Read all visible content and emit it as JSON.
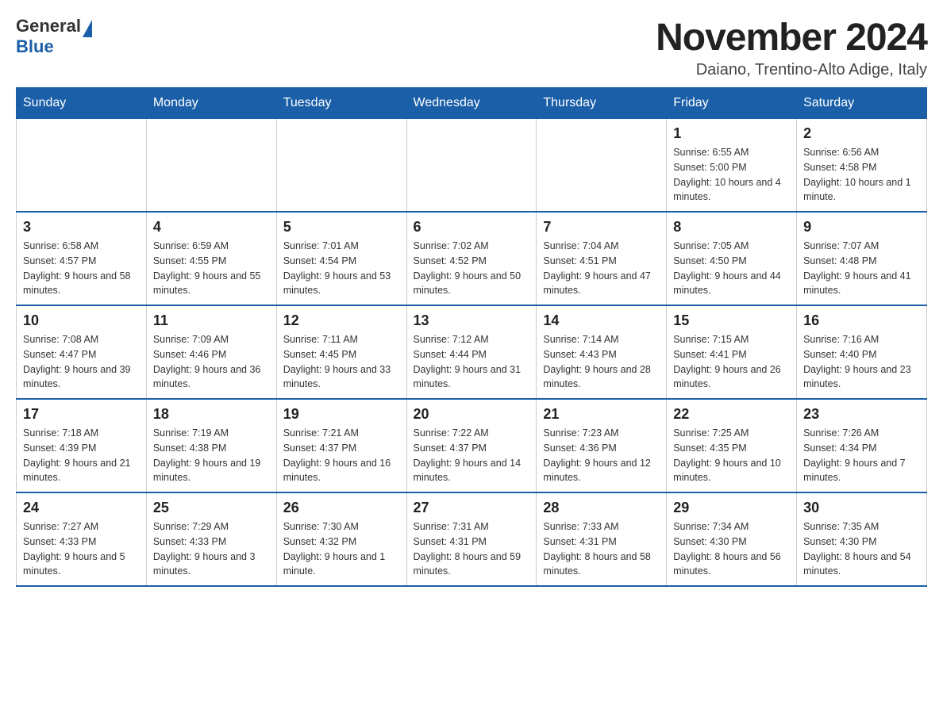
{
  "header": {
    "logo_general": "General",
    "logo_blue": "Blue",
    "title": "November 2024",
    "location": "Daiano, Trentino-Alto Adige, Italy"
  },
  "weekdays": [
    "Sunday",
    "Monday",
    "Tuesday",
    "Wednesday",
    "Thursday",
    "Friday",
    "Saturday"
  ],
  "weeks": [
    [
      {
        "day": "",
        "info": ""
      },
      {
        "day": "",
        "info": ""
      },
      {
        "day": "",
        "info": ""
      },
      {
        "day": "",
        "info": ""
      },
      {
        "day": "",
        "info": ""
      },
      {
        "day": "1",
        "info": "Sunrise: 6:55 AM\nSunset: 5:00 PM\nDaylight: 10 hours and 4 minutes."
      },
      {
        "day": "2",
        "info": "Sunrise: 6:56 AM\nSunset: 4:58 PM\nDaylight: 10 hours and 1 minute."
      }
    ],
    [
      {
        "day": "3",
        "info": "Sunrise: 6:58 AM\nSunset: 4:57 PM\nDaylight: 9 hours and 58 minutes."
      },
      {
        "day": "4",
        "info": "Sunrise: 6:59 AM\nSunset: 4:55 PM\nDaylight: 9 hours and 55 minutes."
      },
      {
        "day": "5",
        "info": "Sunrise: 7:01 AM\nSunset: 4:54 PM\nDaylight: 9 hours and 53 minutes."
      },
      {
        "day": "6",
        "info": "Sunrise: 7:02 AM\nSunset: 4:52 PM\nDaylight: 9 hours and 50 minutes."
      },
      {
        "day": "7",
        "info": "Sunrise: 7:04 AM\nSunset: 4:51 PM\nDaylight: 9 hours and 47 minutes."
      },
      {
        "day": "8",
        "info": "Sunrise: 7:05 AM\nSunset: 4:50 PM\nDaylight: 9 hours and 44 minutes."
      },
      {
        "day": "9",
        "info": "Sunrise: 7:07 AM\nSunset: 4:48 PM\nDaylight: 9 hours and 41 minutes."
      }
    ],
    [
      {
        "day": "10",
        "info": "Sunrise: 7:08 AM\nSunset: 4:47 PM\nDaylight: 9 hours and 39 minutes."
      },
      {
        "day": "11",
        "info": "Sunrise: 7:09 AM\nSunset: 4:46 PM\nDaylight: 9 hours and 36 minutes."
      },
      {
        "day": "12",
        "info": "Sunrise: 7:11 AM\nSunset: 4:45 PM\nDaylight: 9 hours and 33 minutes."
      },
      {
        "day": "13",
        "info": "Sunrise: 7:12 AM\nSunset: 4:44 PM\nDaylight: 9 hours and 31 minutes."
      },
      {
        "day": "14",
        "info": "Sunrise: 7:14 AM\nSunset: 4:43 PM\nDaylight: 9 hours and 28 minutes."
      },
      {
        "day": "15",
        "info": "Sunrise: 7:15 AM\nSunset: 4:41 PM\nDaylight: 9 hours and 26 minutes."
      },
      {
        "day": "16",
        "info": "Sunrise: 7:16 AM\nSunset: 4:40 PM\nDaylight: 9 hours and 23 minutes."
      }
    ],
    [
      {
        "day": "17",
        "info": "Sunrise: 7:18 AM\nSunset: 4:39 PM\nDaylight: 9 hours and 21 minutes."
      },
      {
        "day": "18",
        "info": "Sunrise: 7:19 AM\nSunset: 4:38 PM\nDaylight: 9 hours and 19 minutes."
      },
      {
        "day": "19",
        "info": "Sunrise: 7:21 AM\nSunset: 4:37 PM\nDaylight: 9 hours and 16 minutes."
      },
      {
        "day": "20",
        "info": "Sunrise: 7:22 AM\nSunset: 4:37 PM\nDaylight: 9 hours and 14 minutes."
      },
      {
        "day": "21",
        "info": "Sunrise: 7:23 AM\nSunset: 4:36 PM\nDaylight: 9 hours and 12 minutes."
      },
      {
        "day": "22",
        "info": "Sunrise: 7:25 AM\nSunset: 4:35 PM\nDaylight: 9 hours and 10 minutes."
      },
      {
        "day": "23",
        "info": "Sunrise: 7:26 AM\nSunset: 4:34 PM\nDaylight: 9 hours and 7 minutes."
      }
    ],
    [
      {
        "day": "24",
        "info": "Sunrise: 7:27 AM\nSunset: 4:33 PM\nDaylight: 9 hours and 5 minutes."
      },
      {
        "day": "25",
        "info": "Sunrise: 7:29 AM\nSunset: 4:33 PM\nDaylight: 9 hours and 3 minutes."
      },
      {
        "day": "26",
        "info": "Sunrise: 7:30 AM\nSunset: 4:32 PM\nDaylight: 9 hours and 1 minute."
      },
      {
        "day": "27",
        "info": "Sunrise: 7:31 AM\nSunset: 4:31 PM\nDaylight: 8 hours and 59 minutes."
      },
      {
        "day": "28",
        "info": "Sunrise: 7:33 AM\nSunset: 4:31 PM\nDaylight: 8 hours and 58 minutes."
      },
      {
        "day": "29",
        "info": "Sunrise: 7:34 AM\nSunset: 4:30 PM\nDaylight: 8 hours and 56 minutes."
      },
      {
        "day": "30",
        "info": "Sunrise: 7:35 AM\nSunset: 4:30 PM\nDaylight: 8 hours and 54 minutes."
      }
    ]
  ]
}
